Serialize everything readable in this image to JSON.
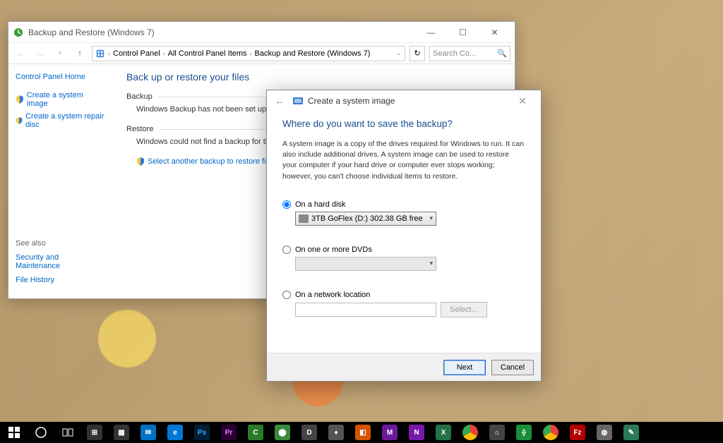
{
  "cp": {
    "title": "Backup and Restore (Windows 7)",
    "breadcrumb": {
      "root": "Control Panel",
      "mid": "All Control Panel Items",
      "leaf": "Backup and Restore (Windows 7)"
    },
    "search_placeholder": "Search Co...",
    "side": {
      "home": "Control Panel Home",
      "task_image": "Create a system image",
      "task_repair": "Create a system repair disc",
      "seealso_h": "See also",
      "seealso_sec": "Security and Maintenance",
      "seealso_hist": "File History"
    },
    "main": {
      "heading": "Back up or restore your files",
      "backup_h": "Backup",
      "backup_msg": "Windows Backup has not been set up.",
      "restore_h": "Restore",
      "restore_msg": "Windows could not find a backup for this computer.",
      "restore_link": "Select another backup to restore files from"
    }
  },
  "wiz": {
    "title": "Create a system image",
    "heading": "Where do you want to save the backup?",
    "desc": "A system image is a copy of the drives required for Windows to run. It can also include additional drives. A system image can be used to restore your computer if your hard drive or computer ever stops working; however, you can't choose individual items to restore.",
    "opt_disk": "On a hard disk",
    "disk_value": "3TB GoFlex (D:)  302.38 GB free",
    "opt_dvd": "On one or more DVDs",
    "opt_net": "On a network location",
    "select_btn": "Select...",
    "next": "Next",
    "cancel": "Cancel"
  }
}
